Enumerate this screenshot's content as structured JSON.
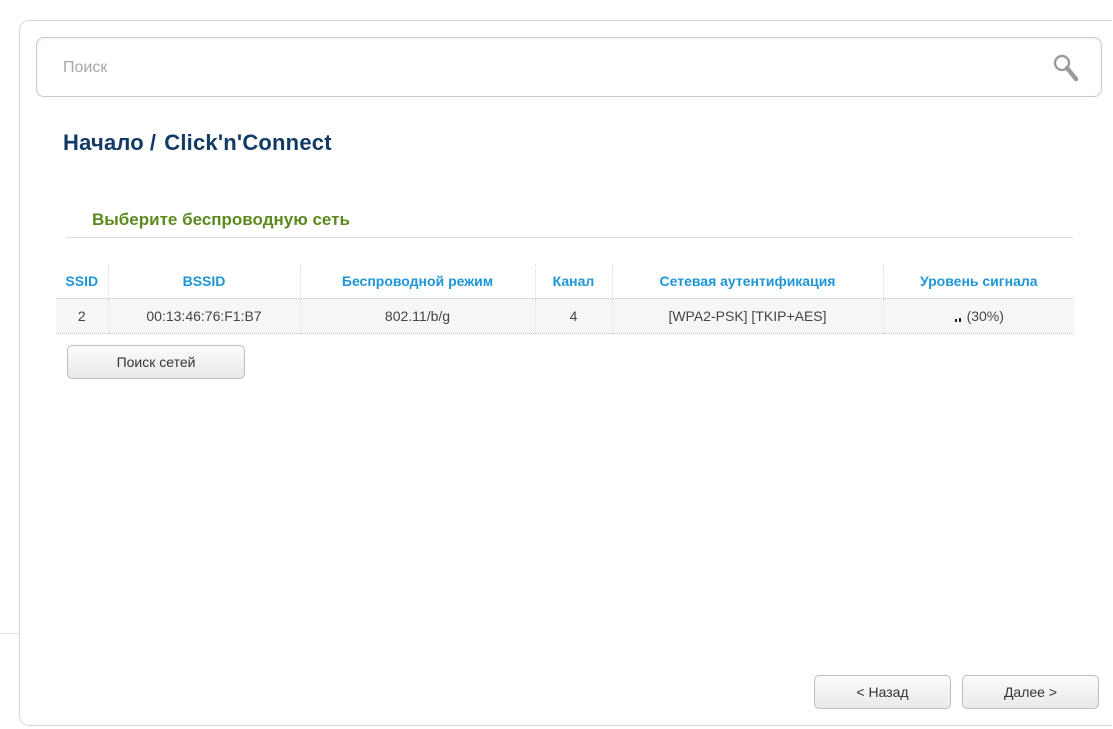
{
  "search": {
    "placeholder": "Поиск"
  },
  "breadcrumb": {
    "home": "Начало",
    "separator": "/",
    "current": "Click'n'Connect"
  },
  "section": {
    "title": "Выберите беспроводную сеть"
  },
  "table": {
    "columns": [
      "SSID",
      "BSSID",
      "Беспроводной режим",
      "Канал",
      "Сетевая аутентификация",
      "Уровень сигнала"
    ],
    "rows": [
      {
        "ssid": "2",
        "bssid": "00:13:46:76:F1:B7",
        "mode": "802.11/b/g",
        "channel": "4",
        "auth": "[WPA2-PSK] [TKIP+AES]",
        "signal": "(30%)",
        "signal_level": 0.3
      }
    ]
  },
  "buttons": {
    "rescan": "Поиск сетей",
    "back": "< Назад",
    "next": "Далее >"
  },
  "icons": {
    "search": "search-icon",
    "signal": "signal-strength-icon"
  },
  "colors": {
    "title": "#123a66",
    "section_title": "#5c8a1e",
    "column_header": "#1e96d6"
  }
}
